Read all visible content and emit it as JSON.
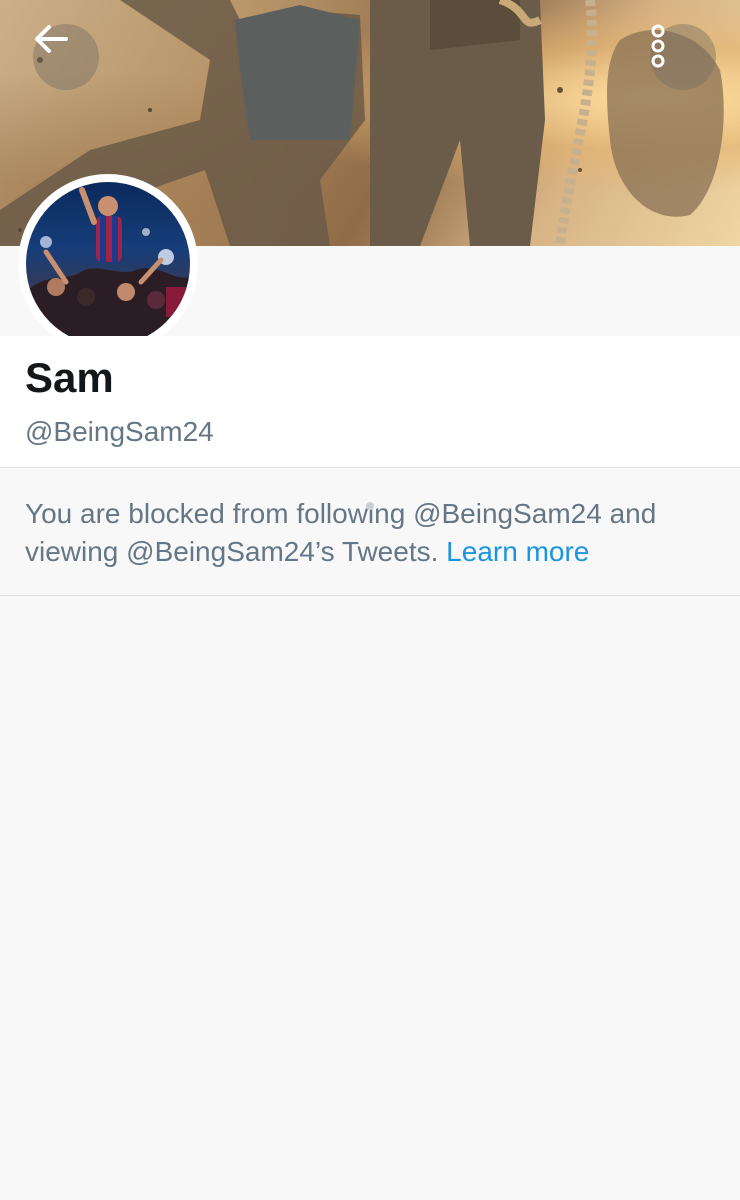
{
  "profile": {
    "display_name": "Sam",
    "handle": "@BeingSam24"
  },
  "header": {
    "back_icon": "arrow-left-icon",
    "more_icon": "vertical-dots-icon"
  },
  "blocked_notice": {
    "text": "You are blocked from following @BeingSam24 and viewing @BeingSam24’s Tweets.",
    "link_label": "Learn more"
  },
  "colors": {
    "link": "#1b95e0",
    "secondary_text": "#657786",
    "primary_text": "#14171a"
  }
}
